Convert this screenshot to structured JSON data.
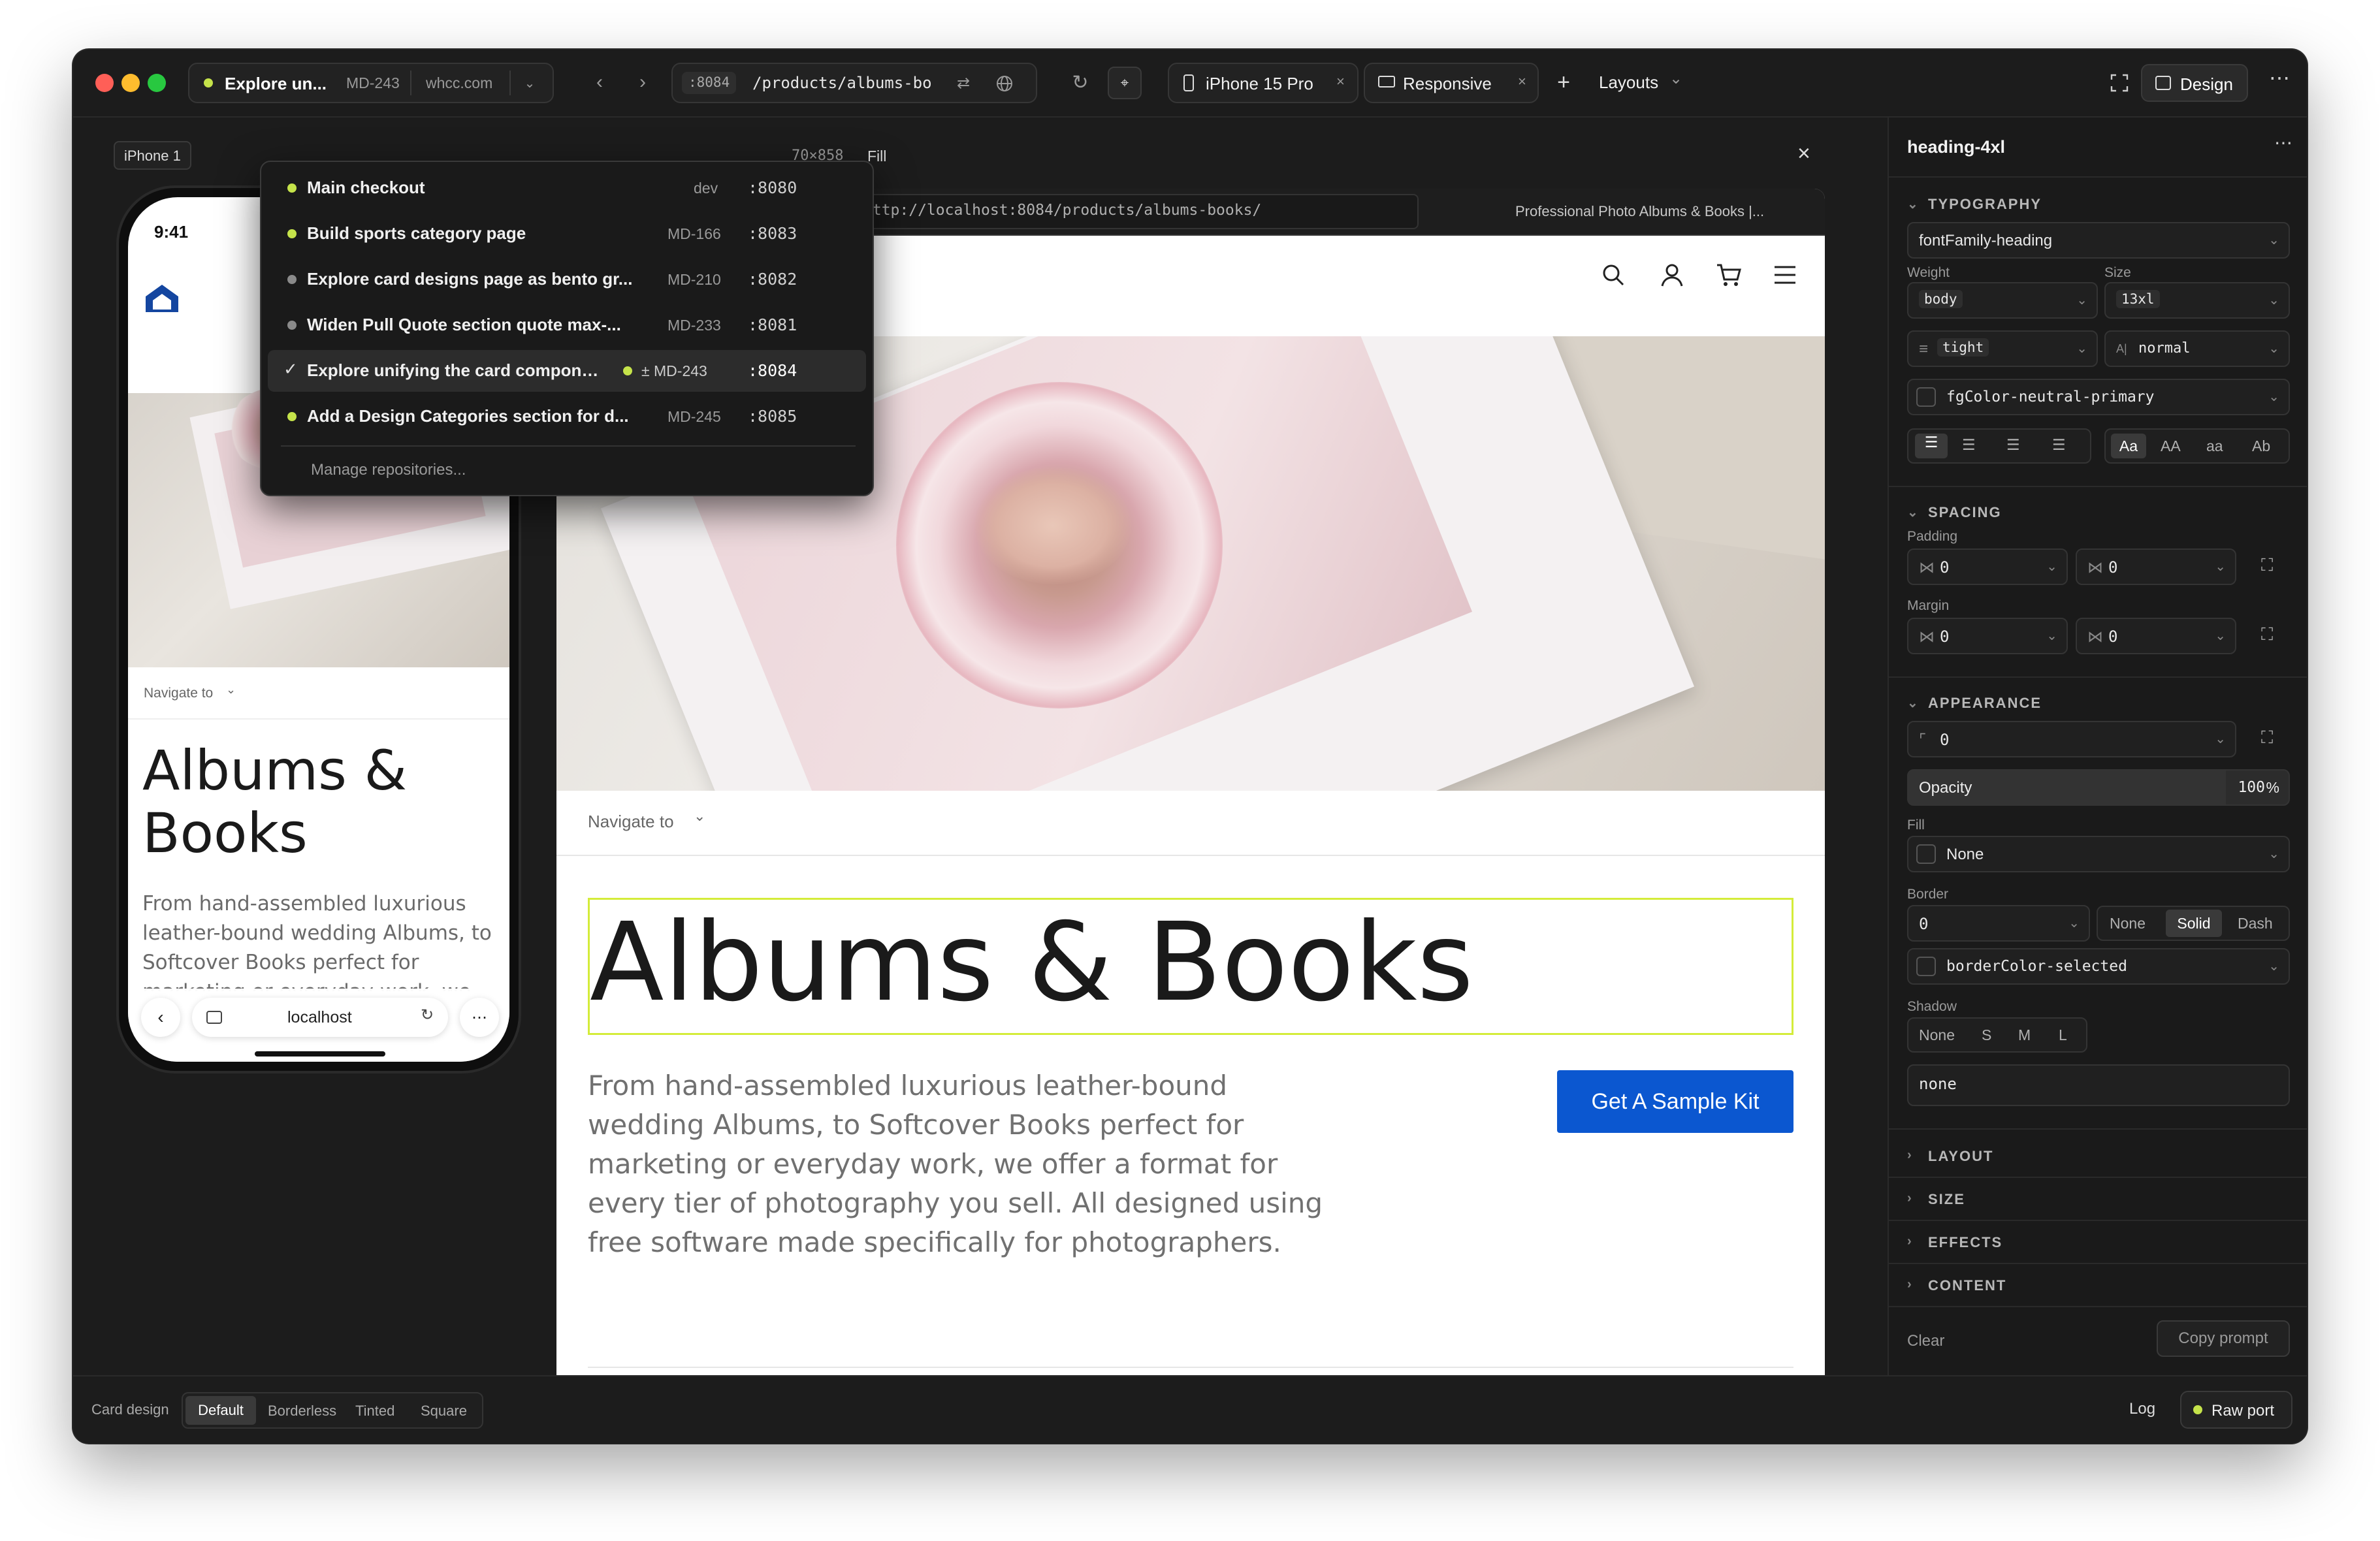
{
  "topbar": {
    "branch_label": "Explore un...",
    "branch_ticket": "MD-243",
    "branch_host": "whcc.com",
    "url_port": ":8084",
    "url_path": "/products/albums-bo",
    "device_label": "iPhone 15 Pro",
    "responsive_label": "Responsive",
    "layouts_label": "Layouts",
    "design_label": "Design"
  },
  "dropdown": {
    "items": [
      {
        "label": "Main checkout",
        "ticket": "dev",
        "port": ":8080",
        "status": "green",
        "selected": false
      },
      {
        "label": "Build sports category page",
        "ticket": "MD-166",
        "port": ":8083",
        "status": "green",
        "selected": false
      },
      {
        "label": "Explore card designs page as bento gr...",
        "ticket": "MD-210",
        "port": ":8082",
        "status": "gray",
        "selected": false
      },
      {
        "label": "Widen Pull Quote section quote max-...",
        "ticket": "MD-233",
        "port": ":8081",
        "status": "gray",
        "selected": false
      },
      {
        "label": "Explore unifying the card compone...",
        "ticket": "± MD-243",
        "port": ":8084",
        "status": "check",
        "selected": true
      },
      {
        "label": "Add a Design Categories section for d...",
        "ticket": "MD-245",
        "port": ":8085",
        "status": "green",
        "selected": false
      }
    ],
    "manage_label": "Manage repositories..."
  },
  "canvas": {
    "phone_tag": "iPhone 1",
    "viewport_size": "70×858",
    "viewport_mode": "Fill",
    "browser_url": "http://localhost:8084/products/albums-books/",
    "browser_title": "Professional Photo Albums & Books |..."
  },
  "phone": {
    "time": "9:41",
    "navigate": "Navigate to",
    "heading": "Albums & Books",
    "body": "From hand-assembled luxurious leather-bound wedding Albums, to Softcover Books perfect for marketing or everyday work, we",
    "address": "localhost"
  },
  "page": {
    "navigate": "Navigate to",
    "heading": "Albums & Books",
    "body": "From hand-assembled luxurious leather-bound wedding Albums, to Softcover Books perfect for marketing or everyday work, we offer a format for every tier of photography you sell. All designed using free software made specifically for photographers.",
    "cta": "Get A Sample Kit",
    "cta_color": "#0b57d0"
  },
  "panel": {
    "element_name": "heading-4xl",
    "typography": {
      "title": "TYPOGRAPHY",
      "font_family": "fontFamily-heading",
      "weight_label": "Weight",
      "size_label": "Size",
      "weight": "body",
      "size": "13xl",
      "line_height": "tight",
      "letter_spacing": "normal",
      "color": "fgColor-neutral-primary",
      "case_options": [
        "Aa",
        "AA",
        "aa",
        "Ab"
      ]
    },
    "spacing": {
      "title": "SPACING",
      "padding_label": "Padding",
      "padding_x": "0",
      "padding_y": "0",
      "margin_label": "Margin",
      "margin_x": "0",
      "margin_y": "0"
    },
    "appearance": {
      "title": "APPEARANCE",
      "radius": "0",
      "opacity_label": "Opacity",
      "opacity_value": "100",
      "opacity_unit": "%",
      "fill_label": "Fill",
      "fill_value": "None",
      "border_label": "Border",
      "border_width": "0",
      "border_styles": [
        "None",
        "Solid",
        "Dash"
      ],
      "border_color": "borderColor-selected",
      "shadow_label": "Shadow",
      "shadow_options": [
        "None",
        "S",
        "M",
        "L"
      ],
      "shadow_value": "none"
    },
    "collapsed_sections": [
      "LAYOUT",
      "SIZE",
      "EFFECTS",
      "CONTENT"
    ],
    "clear_label": "Clear",
    "copy_label": "Copy prompt"
  },
  "bottombar": {
    "card_label": "Card design",
    "variants": [
      "Default",
      "Borderless",
      "Tinted",
      "Square"
    ],
    "log_label": "Log",
    "raw_port_label": "Raw port"
  },
  "colors": {
    "accent_green": "#c5e34a",
    "selection": "#d4ec3a",
    "window_bg": "#1c1c1c"
  }
}
